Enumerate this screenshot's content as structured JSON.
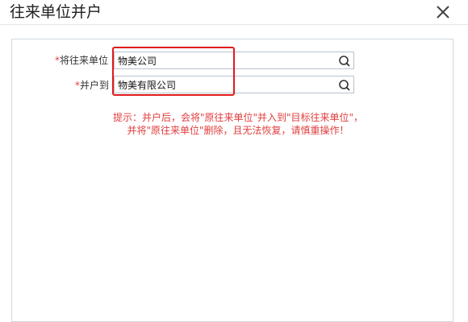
{
  "dialog": {
    "title": "往来单位并户",
    "close_icon": "close-icon"
  },
  "form": {
    "source": {
      "required_mark": "*",
      "label": "将往来单位",
      "value": "物美公司",
      "icon": "search-icon"
    },
    "target": {
      "required_mark": "*",
      "label": "并户到",
      "value": "物美有限公司",
      "icon": "search-icon"
    }
  },
  "notice": {
    "line1": "提示：并户后，会将\"原往来单位\"并入到\"目标往来单位\"，",
    "line2": "并将\"原往来单位\"删除，且无法恢复，请慎重操作！"
  },
  "colors": {
    "required": "#e03b3b",
    "notice": "#e23d3d",
    "highlight": "#e11a1a",
    "border": "#b9c3cf"
  }
}
